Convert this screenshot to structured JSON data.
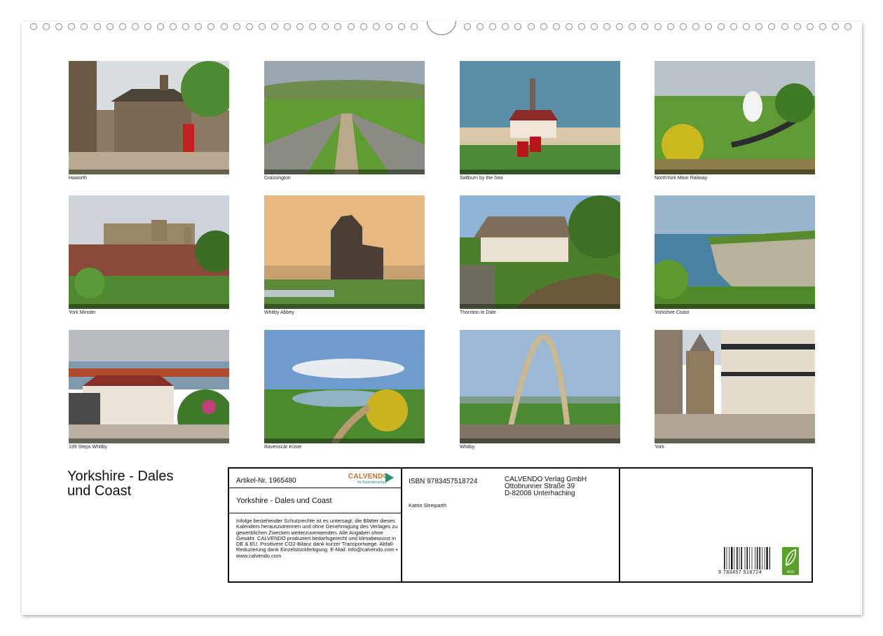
{
  "calendar": {
    "title_line1": "Yorkshire - Dales",
    "title_line2": "und Coast",
    "images": [
      {
        "caption": "Haworth",
        "scene": "village"
      },
      {
        "caption": "Grassington",
        "scene": "dales"
      },
      {
        "caption": "Saltburn by the Sea",
        "scene": "pier"
      },
      {
        "caption": "NorthYork Moor Railway",
        "scene": "railway"
      },
      {
        "caption": "York Minster",
        "scene": "minster"
      },
      {
        "caption": "Whitby Abbey",
        "scene": "abbey"
      },
      {
        "caption": "Thornton le Dale",
        "scene": "cottage"
      },
      {
        "caption": "Yorkshire Coast",
        "scene": "cliffs"
      },
      {
        "caption": "199 Steps Whitby",
        "scene": "steps"
      },
      {
        "caption": "Ravenscar Küste",
        "scene": "coast"
      },
      {
        "caption": "Whitby",
        "scene": "whalebone"
      },
      {
        "caption": "York",
        "scene": "street"
      }
    ]
  },
  "imprint": {
    "article_no": "Artikel-Nr. 1965480",
    "brand": "CALVENDO",
    "brand_tagline": "Ihr Kalenderverlag",
    "product_title": "Yorkshire - Dales und Coast",
    "legal_text": "Infolge bestehender Schutzrechte ist es untersagt, die Blätter dieses Kalenders herauszutrennen und ohne Genehmigung des Verlages zu gewerblichen Zwecken weiterzuverwenden. Alle Angaben ohne Gewähr. CALVENDO produziert bedarfsgerecht und klimabewusst in DE & EU. Positivere CO2-Bilanz dank kurzer Transportwege. Abfall-Reduzierung dank Einzelstückfertigung. E-Mail: info@calvendo.com • www.calvendo.com",
    "isbn": "ISBN 9783457518724",
    "author": "Katrin Streiparth",
    "publisher_line1": "CALVENDO Verlag GmbH",
    "publisher_line2": "Ottobrunner Straße 39",
    "publisher_line3": "D-82008 Unterhaching",
    "barcode_number": "9 783457 518724",
    "eco_label": "eco"
  },
  "colors": {
    "eco_green": "#5aa02c",
    "brand_teal": "#2a8a7a",
    "brand_orange": "#c8702a"
  }
}
